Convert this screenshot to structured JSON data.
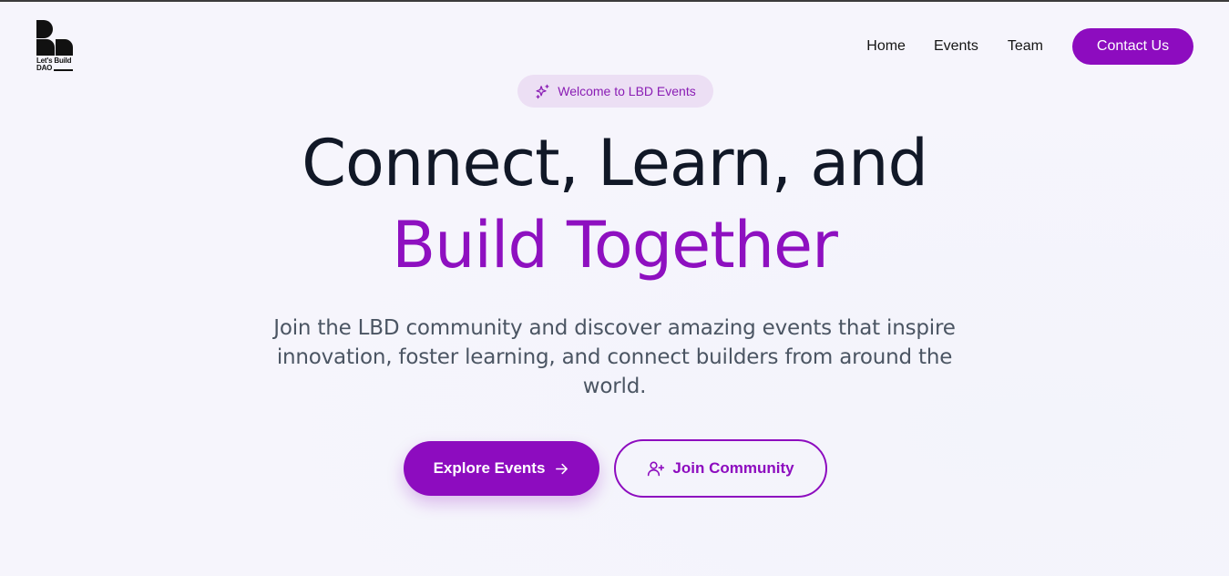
{
  "brand": {
    "logo_text_line1": "Let's Build",
    "logo_text_line2": "DAO"
  },
  "nav": {
    "items": [
      {
        "label": "Home"
      },
      {
        "label": "Events"
      },
      {
        "label": "Team"
      }
    ],
    "cta_label": "Contact Us"
  },
  "hero": {
    "badge": "Welcome to LBD Events",
    "badge_icon": "sparkles-icon",
    "title_line1": "Connect, Learn, and",
    "title_line2": "Build Together",
    "subtitle_line1": "Join the LBD community and discover amazing events that inspire",
    "subtitle_line2": "innovation, foster learning, and connect builders from around the",
    "subtitle_line3": "world.",
    "primary_button": "Explore Events",
    "primary_icon": "arrow-right-icon",
    "secondary_button": "Join Community",
    "secondary_icon": "user-plus-icon"
  },
  "colors": {
    "accent": "#8d0cbf",
    "heading": "#111827",
    "badge_bg": "#ecdff4",
    "background": "#f6f5fc"
  }
}
